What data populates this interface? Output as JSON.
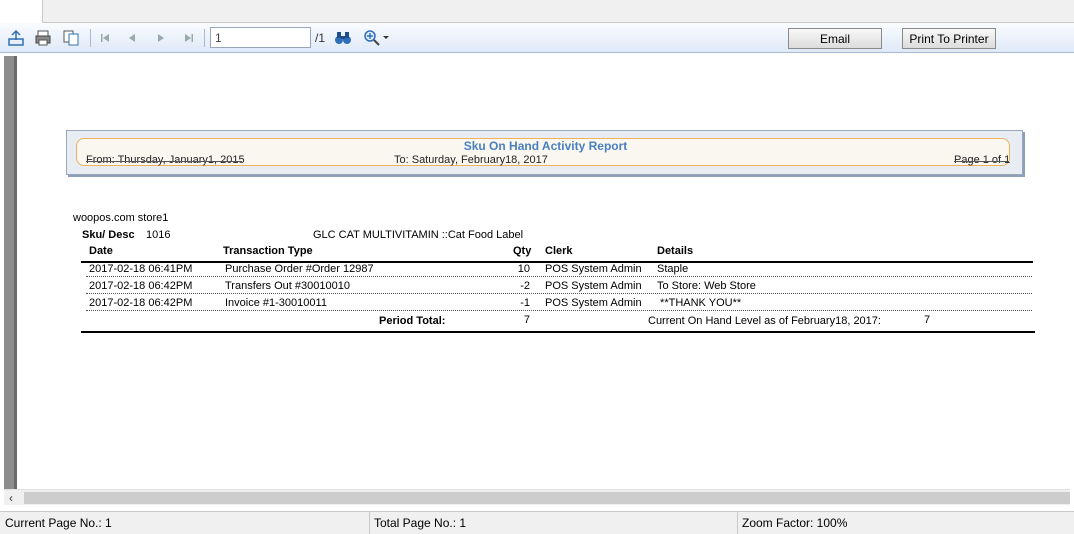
{
  "toolbar": {
    "page_value": "1",
    "page_total": "/1",
    "email_label": "Email",
    "print_label": "Print To Printer"
  },
  "report": {
    "title": "Sku On Hand Activity Report",
    "from": "From: Thursday, January1, 2015",
    "to": "To: Saturday, February18, 2017",
    "page": "Page 1 of 1",
    "store": "woopos.com store1",
    "sku_label": "Sku/ Desc",
    "sku_value": "1016",
    "description": "GLC CAT MULTIVITAMIN ::Cat Food Label",
    "columns": [
      "Date",
      "Transaction Type",
      "Qty",
      "Clerk",
      "Details"
    ],
    "rows": [
      {
        "date": "2017-02-18  06:41PM",
        "type": "Purchase Order #Order 12987",
        "qty": "10",
        "clerk": "POS System Admin",
        "details": "Staple"
      },
      {
        "date": "2017-02-18  06:42PM",
        "type": "Transfers Out #30010010",
        "qty": "-2",
        "clerk": "POS System Admin",
        "details": "To Store: Web Store"
      },
      {
        "date": "2017-02-18  06:42PM",
        "type": "Invoice #1-30010011",
        "qty": "-1",
        "clerk": "POS System Admin",
        "details": " **THANK YOU**"
      }
    ],
    "period_total_label": "Period Total:",
    "period_total_value": "7",
    "on_hand_label": "Current On Hand Level as of February18, 2017:",
    "on_hand_value": "7"
  },
  "status": {
    "current_page": "Current Page No.: 1",
    "total_page": "Total Page No.: 1",
    "zoom": "Zoom Factor: 100%"
  },
  "colors": {
    "title_blue": "#4a7fc0",
    "toolbar_blue": "#2f6fb8",
    "banner_border": "#f0b15a"
  }
}
